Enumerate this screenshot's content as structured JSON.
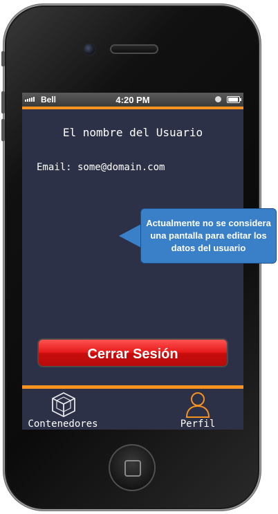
{
  "status_bar": {
    "carrier": "Bell",
    "time": "4:20 PM"
  },
  "profile": {
    "username": "El nombre del Usuario",
    "email": "Email: some@domain.com"
  },
  "logout_button": {
    "label": "Cerrar Sesión"
  },
  "tabs": [
    {
      "label": "Contenedores",
      "icon": "cube-icon",
      "active": false
    },
    {
      "label": "Perfil",
      "icon": "user-icon",
      "active": true
    }
  ],
  "callout": {
    "lines": [
      "Actualmente no se considera",
      "una pantalla para editar los",
      "datos del usuario"
    ]
  },
  "colors": {
    "accent": "#f7931e",
    "screen_bg": "#2c3148",
    "logout_red": "#e61a1a",
    "callout_blue": "#3a80c8"
  }
}
